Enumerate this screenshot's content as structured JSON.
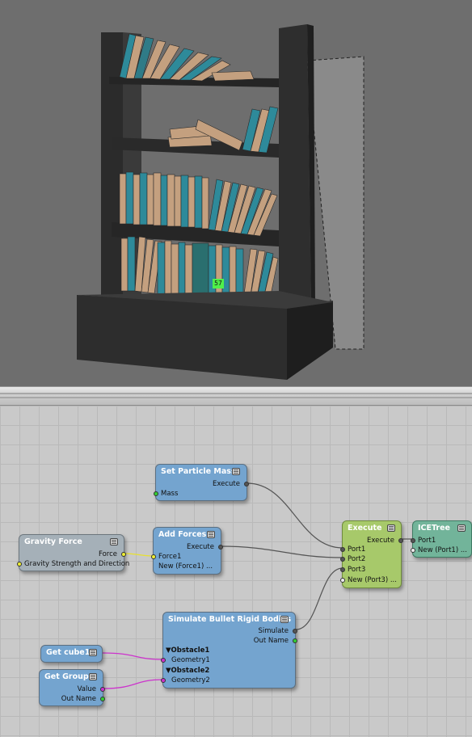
{
  "viewport": {
    "frame_marker": "57"
  },
  "graph": {
    "nodes": {
      "set_particle_mass": {
        "title": "Set Particle Mass",
        "ports": {
          "execute": "Execute",
          "mass": "Mass"
        }
      },
      "gravity_force": {
        "title": "Gravity Force",
        "ports": {
          "force": "Force",
          "gravity": "Gravity Strength and Direction"
        }
      },
      "add_forces": {
        "title": "Add Forces",
        "ports": {
          "execute": "Execute",
          "force1": "Force1",
          "new_force1": "New (Force1) ..."
        }
      },
      "execute": {
        "title": "Execute",
        "ports": {
          "execute": "Execute",
          "port1": "Port1",
          "port2": "Port2",
          "port3": "Port3",
          "new_port3": "New (Port3) ..."
        }
      },
      "icetree": {
        "title": "ICETree",
        "ports": {
          "port1": "Port1",
          "new_port1": "New (Port1) ..."
        }
      },
      "simulate": {
        "title": "Simulate Bullet Rigid Bodies",
        "ports": {
          "simulate": "Simulate",
          "out_name": "Out Name",
          "obstacle1": "▼Obstacle1",
          "geometry1": "Geometry1",
          "obstacle2": "▼Obstacle2",
          "geometry2": "Geometry2"
        }
      },
      "get_cube1": {
        "title": "Get cube1"
      },
      "get_group": {
        "title": "Get Group",
        "ports": {
          "value": "Value",
          "out_name": "Out Name"
        }
      }
    }
  },
  "colors": {
    "node_blue": "#74a4cf",
    "node_green": "#a7c96a",
    "node_teal": "#72b49a",
    "node_grey": "#a5b0b8",
    "wire_grey": "#555555",
    "wire_yellow": "#e8e030",
    "wire_magenta": "#cc33cc"
  }
}
